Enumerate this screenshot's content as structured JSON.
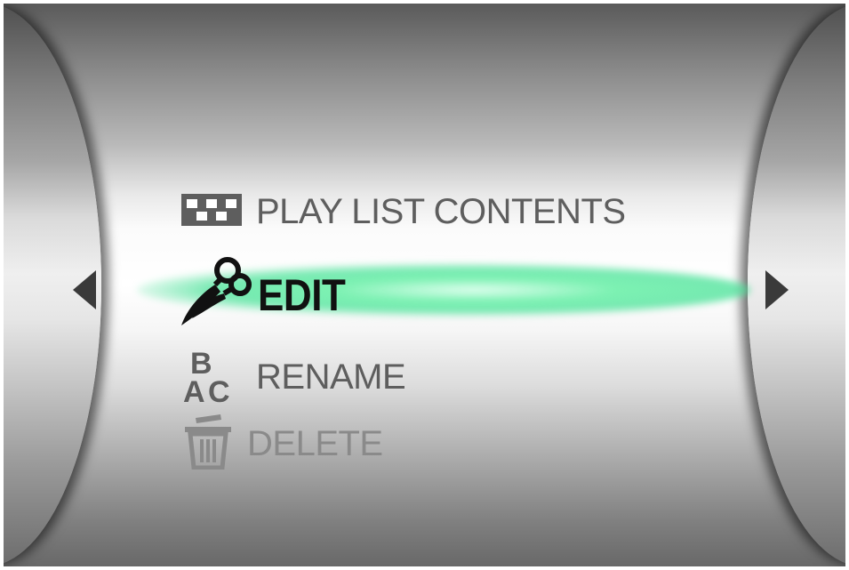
{
  "menu": {
    "items": [
      {
        "label": "PLAY LIST CONTENTS",
        "icon": "playlist-grid-icon",
        "state": "normal"
      },
      {
        "label": "EDIT",
        "icon": "scissors-icon",
        "state": "selected"
      },
      {
        "label": "RENAME",
        "icon": "abc-rename-icon",
        "state": "normal"
      },
      {
        "label": "DELETE",
        "icon": "trash-icon",
        "state": "disabled"
      }
    ]
  },
  "colors": {
    "highlight": "#5ee6a0",
    "text_normal": "#5e5e5e",
    "text_selected": "#111111",
    "text_disabled": "#8a8a8a",
    "arrow": "#3a3a3a"
  }
}
